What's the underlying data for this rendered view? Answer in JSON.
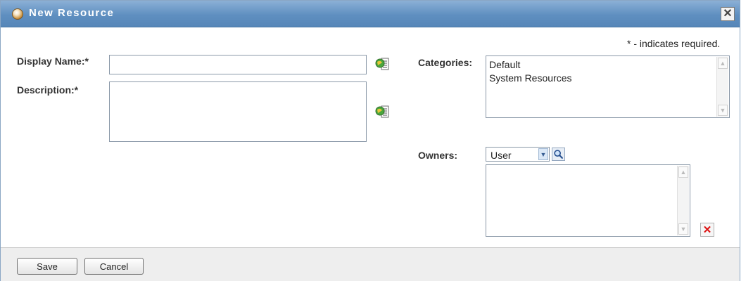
{
  "dialog": {
    "title": "New Resource",
    "close_icon": "close-icon",
    "title_icon": "resource-icon",
    "required_note": "* - indicates required."
  },
  "form": {
    "display_name": {
      "label": "Display Name:*",
      "value": "",
      "icon": "localize-icon"
    },
    "description": {
      "label": "Description:*",
      "value": "",
      "icon": "localize-icon"
    },
    "categories": {
      "label": "Categories:",
      "items": [
        "Default",
        "System Resources"
      ]
    },
    "owners": {
      "label": "Owners:",
      "type_selected": "User",
      "search_icon": "magnifier-icon",
      "items": [],
      "delete_icon": "delete-icon"
    }
  },
  "footer": {
    "save_label": "Save",
    "cancel_label": "Cancel"
  },
  "colors": {
    "titlebar": "#5f8fc0",
    "delete": "#dd1111",
    "footer_bg": "#eeeeee"
  }
}
